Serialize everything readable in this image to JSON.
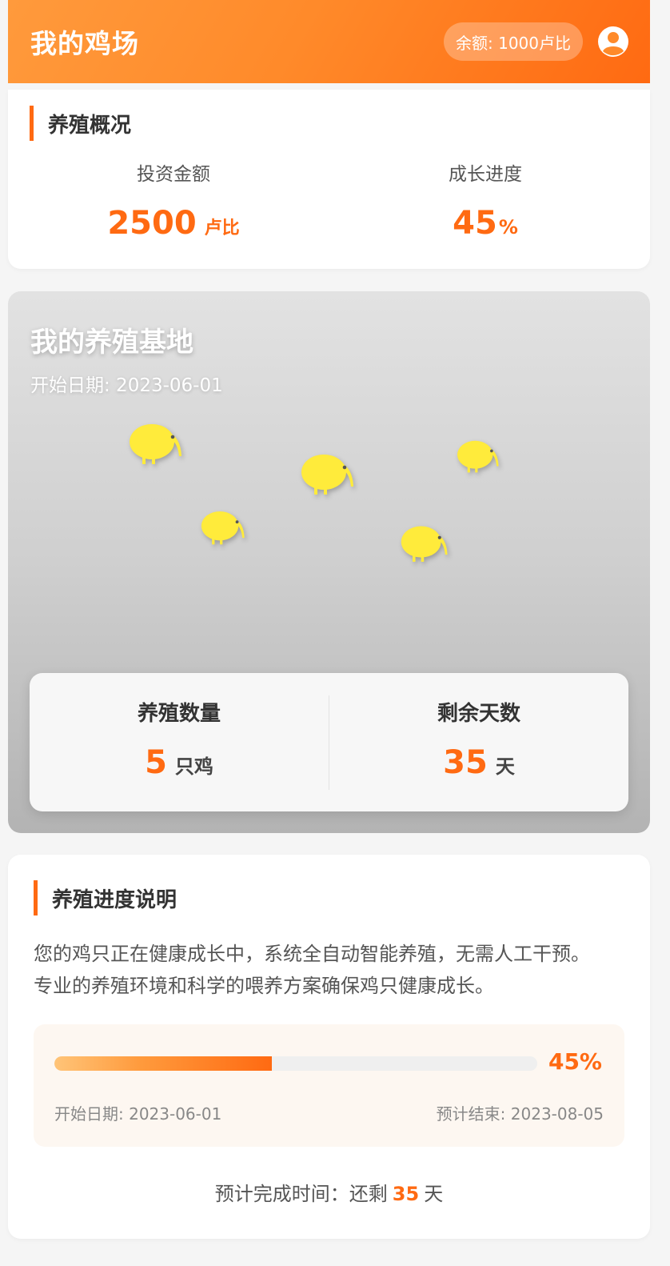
{
  "header": {
    "title": "我的鸡场",
    "balance": "余额: 1000卢比",
    "avatar_icon": "user-circle-icon"
  },
  "overview": {
    "title": "养殖概况",
    "investment": {
      "label": "投资金额",
      "value": "2500",
      "unit": "卢比"
    },
    "growth": {
      "label": "成长进度",
      "value": "45",
      "unit": "%"
    }
  },
  "farm": {
    "title": "我的养殖基地",
    "start_date": "开始日期: 2023-06-01",
    "chick_icon": "kiwi-bird-icon",
    "chick_color": "#ffeb3b",
    "count": {
      "label": "养殖数量",
      "value": "5",
      "unit": "只鸡"
    },
    "days_left": {
      "label": "剩余天数",
      "value": "35",
      "unit": "天"
    }
  },
  "progress": {
    "title": "养殖进度说明",
    "desc_line1": "您的鸡只正在健康成长中，系统全自动智能养殖，无需人工干预。",
    "desc_line2": "专业的养殖环境和科学的喂养方案确保鸡只健康成长。",
    "percent_label": "45%",
    "percent_value": 0.45,
    "start": "开始日期: 2023-06-01",
    "end": "预计结束: 2023-08-05",
    "eta_prefix": "预计完成时间：还剩",
    "eta_days": "35",
    "eta_suffix": "天"
  },
  "colors": {
    "accent": "#ff6a12",
    "header_start": "#ff9a3c",
    "header_end": "#ff6a12"
  }
}
